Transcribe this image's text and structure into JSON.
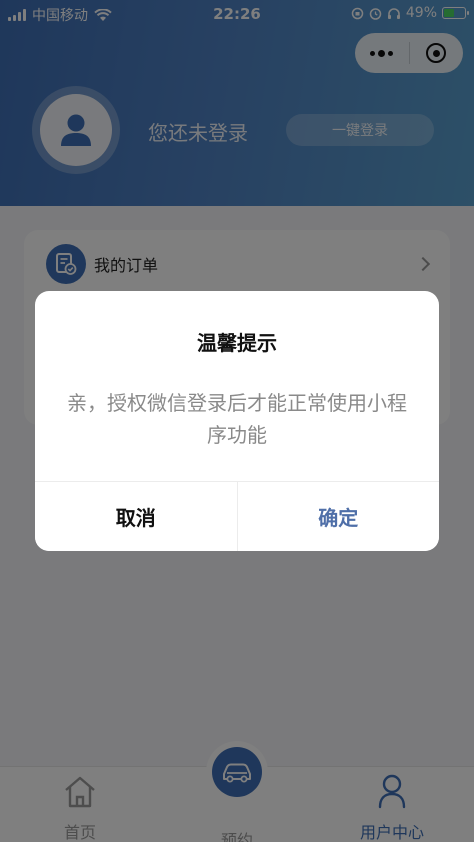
{
  "status_bar": {
    "carrier": "中国移动",
    "time": "22:26",
    "battery": "49%",
    "battery_level": 0.49
  },
  "capsule": {
    "more_icon": "more-dots-icon",
    "close_icon": "target-close-icon"
  },
  "profile": {
    "status_text": "您还未登录",
    "login_button": "一键登录",
    "avatar_icon": "user-avatar-icon"
  },
  "orders": {
    "label": "我的订单",
    "icon": "order-list-icon"
  },
  "tabbar": {
    "items": [
      {
        "label": "首页",
        "icon": "home-icon"
      },
      {
        "label": "预约",
        "icon": "car-icon"
      },
      {
        "label": "用户中心",
        "icon": "user-icon"
      }
    ]
  },
  "dialog": {
    "title": "温馨提示",
    "message": "亲，授权微信登录后才能正常使用小程序功能",
    "cancel": "取消",
    "confirm": "确定"
  },
  "colors": {
    "accent": "#3e6fb6",
    "confirm_text": "#4f6fa8",
    "overlay": "rgba(0,0,0,0.5)"
  }
}
